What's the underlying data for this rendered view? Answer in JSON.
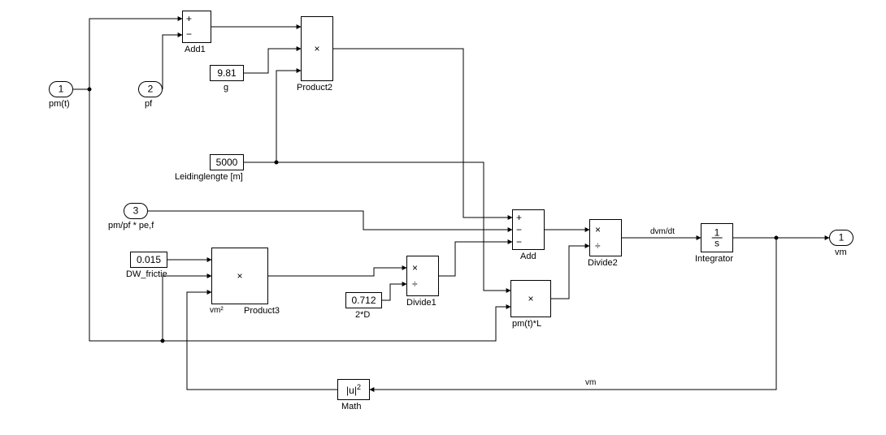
{
  "ports": {
    "in1": {
      "num": "1",
      "label": "pm(t)"
    },
    "in2": {
      "num": "2",
      "label": "pf"
    },
    "in3": {
      "num": "3",
      "label": "pm/pf * pe,f"
    },
    "out1": {
      "num": "1",
      "label": "vm"
    }
  },
  "consts": {
    "g": {
      "value": "9.81",
      "label": "g"
    },
    "L": {
      "value": "5000",
      "label": "Leidinglengte [m]"
    },
    "dw": {
      "value": "0.015",
      "label": "DW_frictie"
    },
    "twoD": {
      "value": "0.712",
      "label": "2*D"
    }
  },
  "blocks": {
    "add1": {
      "label": "Add1",
      "op": "+ −"
    },
    "product2": {
      "label": "Product2",
      "op": "×"
    },
    "product3": {
      "label": "Product3",
      "op": "×",
      "note": "vm²"
    },
    "divide1": {
      "label": "Divide1",
      "op": "× ÷"
    },
    "pmtL": {
      "label": "pm(t)*L",
      "op": "×"
    },
    "add": {
      "label": "Add",
      "ops": "+ − −"
    },
    "divide2": {
      "label": "Divide2",
      "op": "× ÷"
    },
    "integ": {
      "label": "Integrator",
      "disp": "1/s"
    },
    "math": {
      "label": "Math",
      "disp": "|u|²"
    }
  },
  "signals": {
    "dvmdt": "dvm/dt",
    "vm": "vm"
  }
}
